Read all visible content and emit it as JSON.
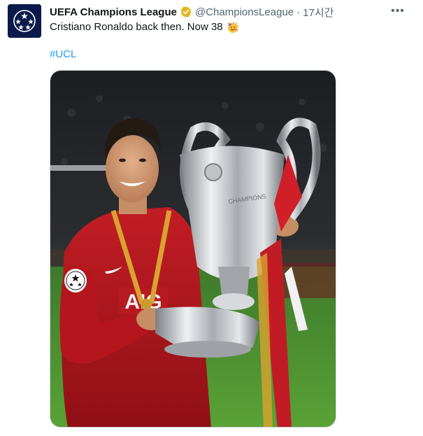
{
  "tweet": {
    "author_name": "UEFA Champions League",
    "author_handle": "@ChampionsLeague",
    "separator": "·",
    "timestamp": "17시간",
    "text": "Cristiano Ronaldo back then. Now 38",
    "hashtag": "#UCL",
    "more_label": "•••"
  },
  "icons": {
    "avatar": "ucl-starball-logo",
    "verified": "gold-verified-badge",
    "emoji": "party-face-emoji",
    "more": "more-options-icon"
  },
  "media": {
    "logo_text": "AIG"
  },
  "colors": {
    "link": "#1d9bf0",
    "secondary_text": "#536471",
    "verified_gold": "#e2b719",
    "avatar_bg": "#0b1a4b"
  }
}
